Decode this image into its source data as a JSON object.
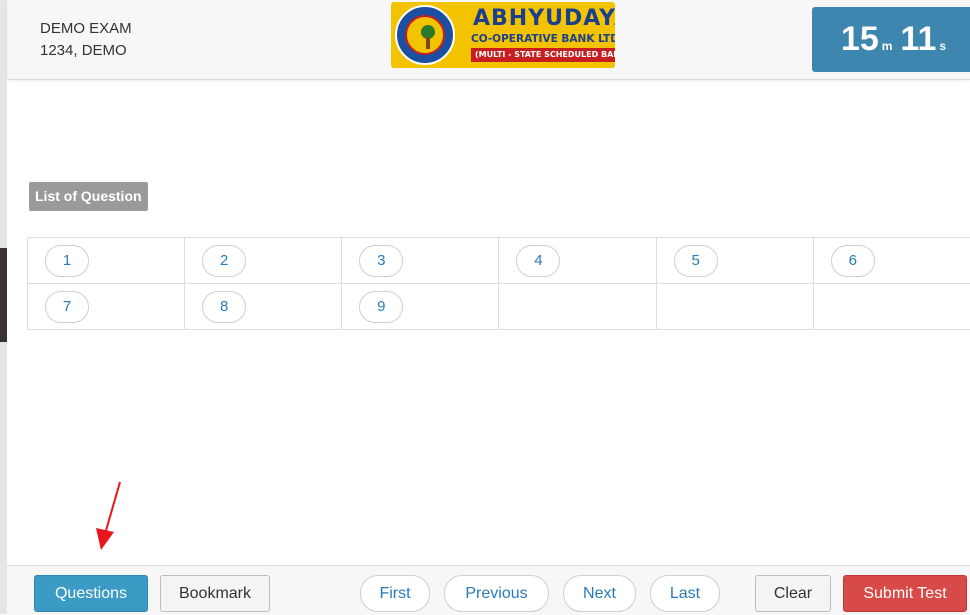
{
  "candidate": {
    "exam_name": "DEMO EXAM",
    "candidate_id": "1234, DEMO"
  },
  "logo": {
    "bank_name": "ABHYUDAYA",
    "bank_subtitle": "CO-OPERATIVE BANK LTD.",
    "bank_tagline": "(MULTI - STATE SCHEDULED BANK)"
  },
  "timer": {
    "minutes": "15",
    "minutes_unit": "m",
    "seconds": "11",
    "seconds_unit": "s"
  },
  "question_list": {
    "label": "List of Question",
    "rows": [
      [
        "1",
        "2",
        "3",
        "4",
        "5",
        "6"
      ],
      [
        "7",
        "8",
        "9",
        "",
        "",
        ""
      ]
    ]
  },
  "footer": {
    "questions_label": "Questions",
    "bookmark_label": "Bookmark",
    "first_label": "First",
    "previous_label": "Previous",
    "next_label": "Next",
    "last_label": "Last",
    "clear_label": "Clear",
    "submit_label": "Submit Test"
  },
  "colors": {
    "timer_bg": "#3d86b0",
    "questions_button": "#3b9bc4",
    "submit_button": "#d84a48",
    "link_blue": "#2a7ab8",
    "arrow": "#e8151b"
  },
  "icons": {
    "annotation": "red-arrow-icon",
    "logo": "bank-seal-icon"
  }
}
